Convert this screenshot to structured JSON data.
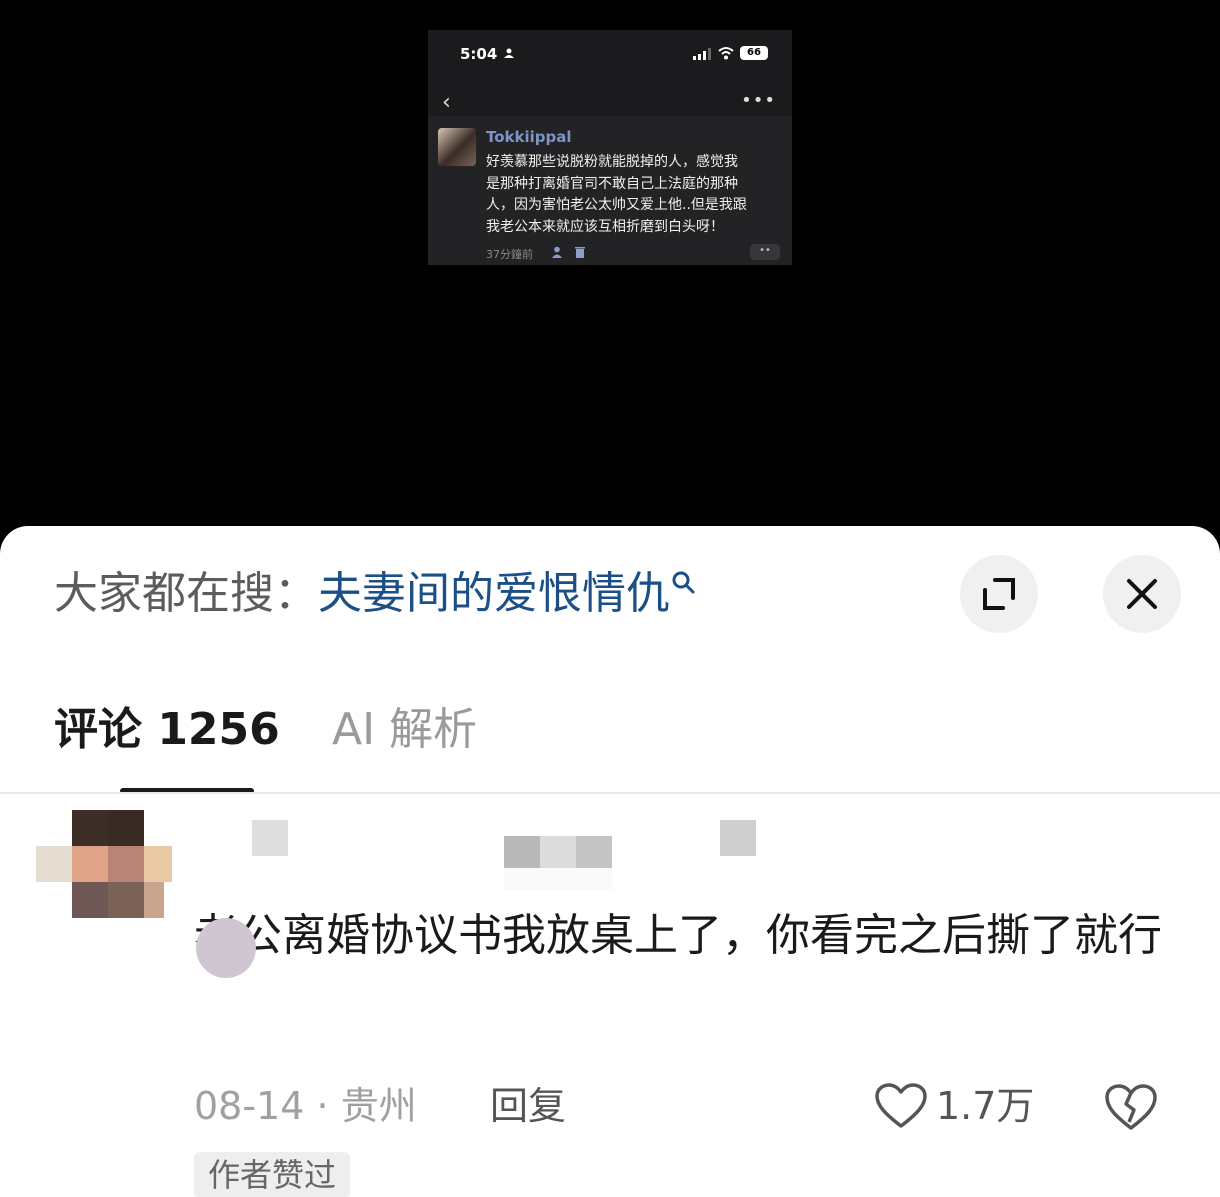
{
  "embedded_screenshot": {
    "status_bar": {
      "time": "5:04",
      "battery": "66"
    },
    "post": {
      "username": "Tokkiippal",
      "text_lines": [
        "好羡慕那些说脱粉就能脱掉的人，感觉我",
        "是那种打离婚官司不敢自己上法庭的那种",
        "人，因为害怕老公太帅又爱上他..但是我跟",
        "我老公本来就应该互相折磨到白头呀！"
      ],
      "time_ago": "37分鐘前",
      "more_button": "••"
    }
  },
  "sheet": {
    "search": {
      "prefix": "大家都在搜：",
      "query": "夫妻间的爱恨情仇"
    },
    "tabs": [
      {
        "label": "评论 1256",
        "active": true
      },
      {
        "label": "AI 解析",
        "active": false
      }
    ],
    "comment": {
      "text": "老公离婚协议书我放桌上了，你看完之后撕了就行",
      "date": "08-14",
      "separator": "·",
      "location": "贵州",
      "reply_label": "回复",
      "likes": "1.7万",
      "badge": "作者赞过"
    }
  },
  "colors": {
    "link": "#1c4f86",
    "username": "#7c95c6",
    "sheet_bg": "#ffffff"
  }
}
